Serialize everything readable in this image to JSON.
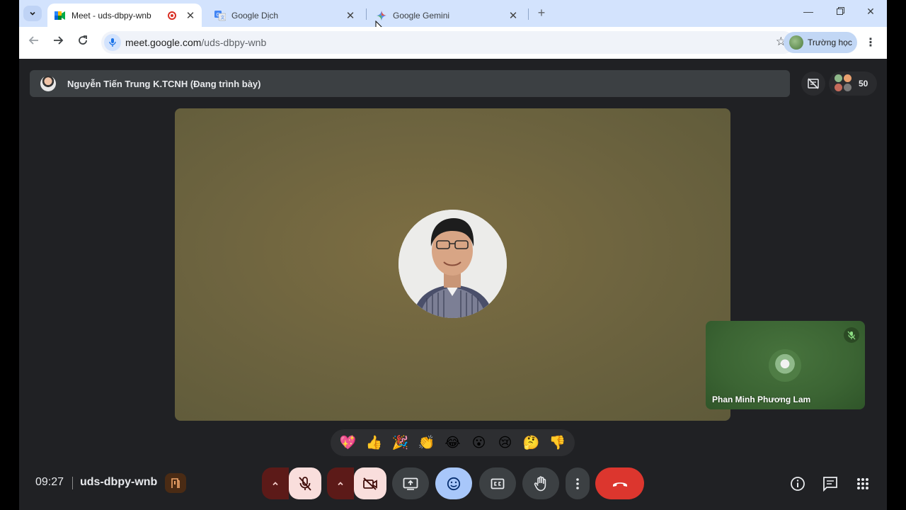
{
  "browser": {
    "tabs": [
      {
        "title": "Meet - uds-dbpy-wnb",
        "favicon": "google-meet-icon",
        "recording": true,
        "active": true
      },
      {
        "title": "Google Dịch",
        "favicon": "google-translate-icon",
        "active": false
      },
      {
        "title": "Google Gemini",
        "favicon": "gemini-icon",
        "active": false
      }
    ],
    "address": {
      "host": "meet.google.com",
      "path": "/uds-dbpy-wnb"
    },
    "profile_label": "Trường học"
  },
  "meet": {
    "presenter_label": "Nguyễn Tiến Trung K.TCNH (Đang trình bày)",
    "participant_count": "50",
    "self_tile_name": "Phan Minh Phương Lam",
    "reactions": [
      "💖",
      "👍",
      "🎉",
      "👏",
      "😂",
      "😮",
      "😢",
      "🤔",
      "👎"
    ],
    "time": "09:27",
    "meeting_code": "uds-dbpy-wnb"
  },
  "colors": {
    "tab_strip": "#d3e3fd",
    "meet_background": "#202124",
    "end_call": "#dc362e",
    "muted_control": "#f9dedc",
    "active_control": "#a8c7fa"
  }
}
